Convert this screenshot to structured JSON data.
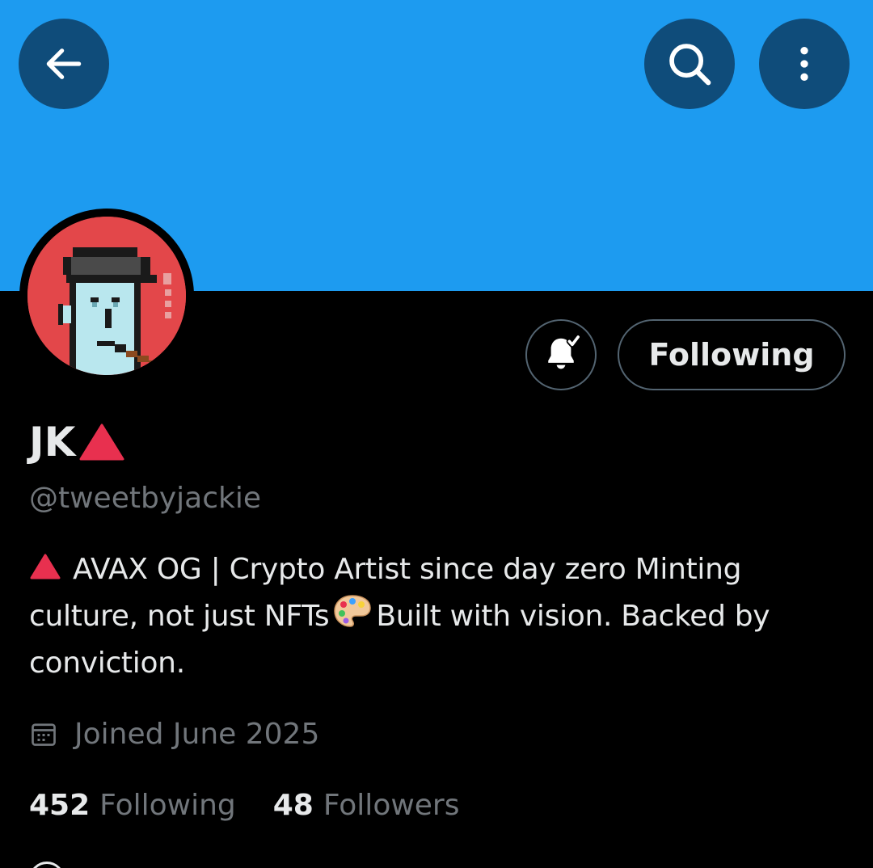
{
  "header": {
    "banner_color": "#1d9bf0",
    "back_icon": "arrow-left-icon",
    "search_icon": "search-icon",
    "more_icon": "more-vertical-icon"
  },
  "profile": {
    "display_name": "JK",
    "name_badge_icon": "red-triangle-icon",
    "handle": "@tweetbyjackie",
    "avatar_icon": "pixel-punk-avatar"
  },
  "actions": {
    "notification_icon": "bell-check-icon",
    "follow_label": "Following"
  },
  "bio": {
    "part1": "AVAX OG | Crypto Artist since day zero Minting culture, not just NFTs",
    "part2": "Built with vision. Backed by conviction.",
    "lead_icon": "red-triangle-icon",
    "emoji_icon": "palette-icon"
  },
  "meta": {
    "joined_icon": "calendar-icon",
    "joined_text": "Joined June 2025"
  },
  "stats": {
    "following_count": "452",
    "following_label": "Following",
    "followers_count": "48",
    "followers_label": "Followers"
  },
  "colors": {
    "background": "#000000",
    "text_primary": "#e7e9ea",
    "text_secondary": "#71767b",
    "button_border": "#536471",
    "header_button": "#0f4c7a",
    "triangle_red": "#e8304f"
  }
}
